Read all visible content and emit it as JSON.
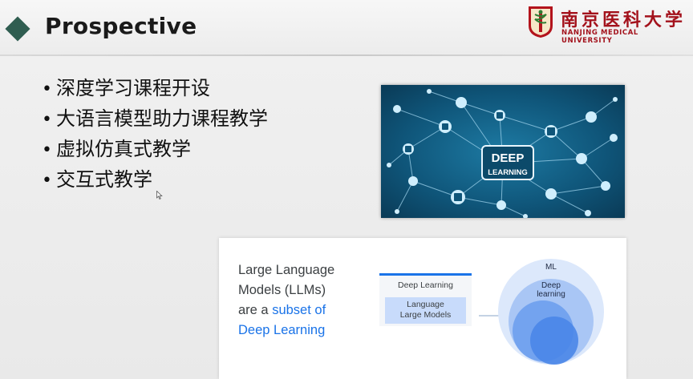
{
  "slide": {
    "title": "Prospective",
    "bullets": [
      "深度学习课程开设",
      "大语言模型助力课程教学",
      "虚拟仿真式教学",
      "交互式教学"
    ],
    "bullet_marker": "•"
  },
  "logo": {
    "name_cn": "南京医科大学",
    "name_en": "NANJING MEDICAL UNIVERSITY",
    "color": "#a3121c"
  },
  "deep_learning_image": {
    "line1": "DEEP",
    "line2": "LEARNING"
  },
  "llm_card": {
    "text_line1": "Large Language",
    "text_line2": "Models (LLMs)",
    "text_line3_prefix": "are a ",
    "text_line3_highlight": "subset of",
    "text_line4_highlight": "Deep Learning",
    "box_title": "Deep Learning",
    "inner_line1": "Language",
    "inner_line2": "Large Models",
    "venn_outer": "ML",
    "venn_middle_line1": "Deep",
    "venn_middle_line2": "learning",
    "highlight_color": "#1a73e8"
  },
  "colors": {
    "diamond": "#2f5d50",
    "deep_bg": "#0f4c6b"
  }
}
